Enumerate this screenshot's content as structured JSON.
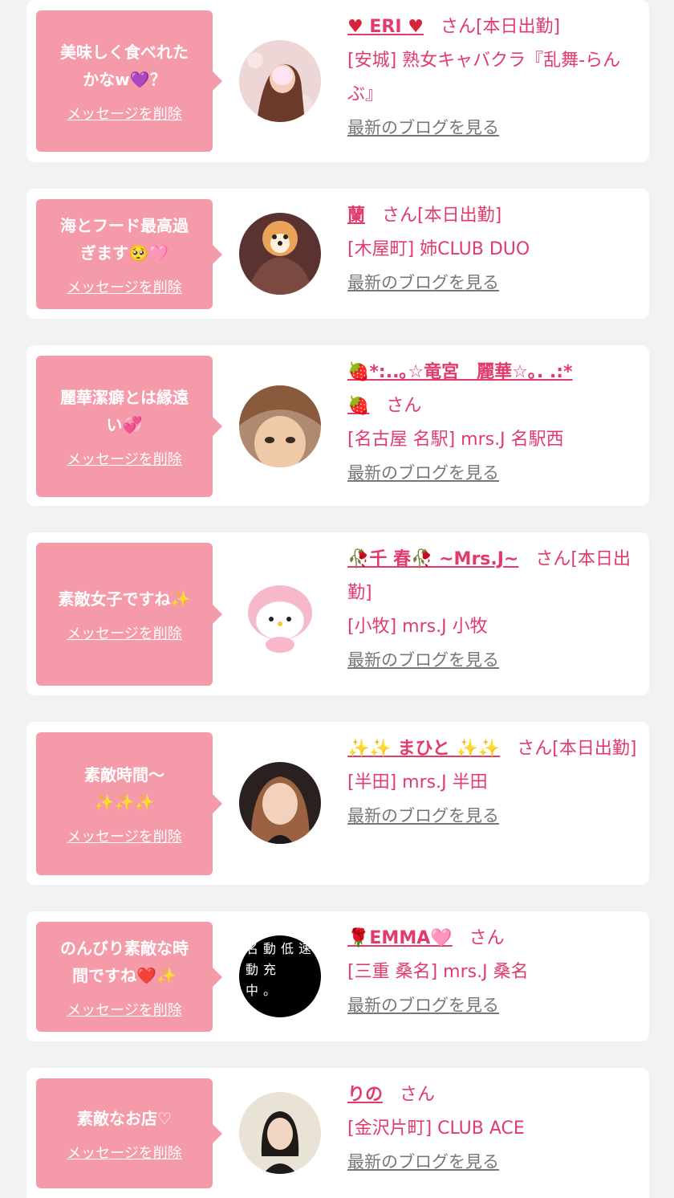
{
  "delete_label": "メッセージを削除",
  "blog_label": "最新のブログを見る",
  "san_label": "さん",
  "colors": {
    "accent": "#e23b6b",
    "bubble": "#f59aa8",
    "card": "#ffffff",
    "bg": "#f2f2f2"
  },
  "entries": [
    {
      "message_a": "美味しく食べれた\nかなw",
      "message_sym": "💜",
      "message_b": "？",
      "name_pre": "♥",
      "name": "ERI",
      "name_post": "♥",
      "status": "[本日出勤]",
      "store": "[安城] 熟女キャバクラ『乱舞-らんぶ』",
      "avatar_icon": "woman-photo-icon"
    },
    {
      "message_a": "海とフード最高過\nぎます",
      "message_sym": "🥺",
      "message_b": "🩷",
      "name_pre": "",
      "name": "蘭",
      "name_post": "",
      "status": "[本日出勤]",
      "store": "[木屋町] 姉CLUB DUO",
      "avatar_icon": "dog-filter-photo-icon"
    },
    {
      "message_a": "麗華潔癖とは縁遠\nい",
      "message_sym": "💞",
      "message_b": "",
      "name_pre": "🍓",
      "name": "*:..｡☆竜宮　麗華☆｡. .:*",
      "name_post": "🍓",
      "status": "",
      "store": "[名古屋 名駅] mrs.J 名駅西",
      "avatar_icon": "woman-selfie-icon"
    },
    {
      "message_a": "素敵女子ですね",
      "message_sym": "✨",
      "message_b": "",
      "name_pre": "🥀",
      "name": "千 春🥀 ~Mrs.J~",
      "name_post": "",
      "status": "[本日出勤]",
      "store": "[小牧] mrs.J 小牧",
      "avatar_icon": "plush-doll-icon"
    },
    {
      "message_a": "素敵時間〜\n",
      "message_sym": "✨✨✨",
      "message_b": "",
      "name_pre": "✨✨",
      "name": "まひと",
      "name_post": "✨✨",
      "status": "[本日出勤]",
      "store": "[半田] mrs.J 半田",
      "avatar_icon": "woman-portrait-icon"
    },
    {
      "message_a": "のんびり素敵な時\n間ですね",
      "message_sym": "❤️",
      "message_b": "✨",
      "name_pre": "🌹",
      "name": "EMMA",
      "name_post": "🩷",
      "status": "",
      "store": "[三重 桑名] mrs.J 桑名",
      "avatar_icon": "text-image-icon",
      "avatar_text": "名動低速\n動充\n中。"
    },
    {
      "message_a": "素敵なお店♡",
      "message_sym": "",
      "message_b": "",
      "name_pre": "",
      "name": "りの",
      "name_post": "",
      "status": "",
      "store": "[金沢片町] CLUB ACE",
      "avatar_icon": "woman-headshot-icon"
    }
  ]
}
